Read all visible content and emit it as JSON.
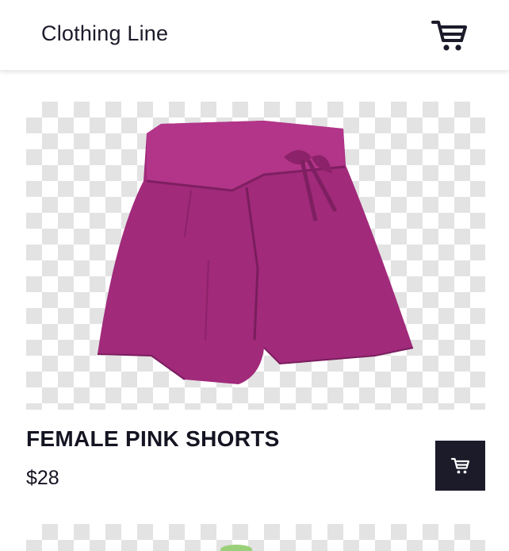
{
  "header": {
    "brand": "Clothing Line",
    "cart_icon": "shopping-cart-icon"
  },
  "products": [
    {
      "name": "FEMALE PINK SHORTS",
      "price": "$28",
      "image_icon": "pink-shorts-image",
      "add_icon": "shopping-cart-icon"
    }
  ],
  "colors": {
    "header_bg": "#ffffff",
    "text": "#1b1b2a",
    "button_bg": "#1b1b2a",
    "shorts": "#a12a7b",
    "checker": "#e3e3e3"
  }
}
